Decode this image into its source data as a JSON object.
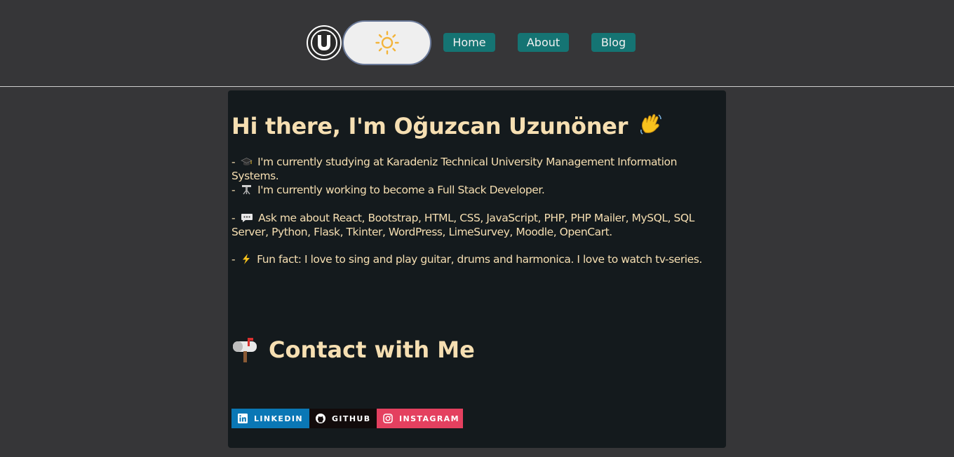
{
  "header": {
    "logo_icon": "u-logo-icon",
    "theme_toggle_icon": "sun-icon",
    "nav": [
      {
        "label": "Home"
      },
      {
        "label": "About"
      },
      {
        "label": "Blog"
      }
    ],
    "colors": {
      "nav_bg": "#157473",
      "background": "#363638"
    }
  },
  "main": {
    "title": "Hi there, I'm Oğuzcan Uzunöner",
    "title_emoji": "waving-hand-icon",
    "lines": [
      {
        "prefix": "-",
        "icon": "graduation-cap-icon",
        "text": "I'm currently studying at Karadeniz Technical University Management Information Systems."
      },
      {
        "prefix": "-",
        "icon": "telescope-icon",
        "text": "I'm currently working to become a Full Stack Developer."
      },
      {
        "prefix": "-",
        "icon": "speech-bubble-icon",
        "text": "Ask me about React, Bootstrap, HTML, CSS, JavaScript, PHP, PHP Mailer, MySQL, SQL Server, Python, Flask, Tkinter, WordPress, LimeSurvey, Moodle, OpenCart."
      },
      {
        "prefix": "-",
        "icon": "lightning-icon",
        "text": "Fun fact: I love to sing and play guitar, drums and harmonica. I love to watch tv-series."
      }
    ],
    "contact_title": "Contact with Me",
    "contact_icon": "mailbox-icon",
    "badges": [
      {
        "label": "LINKEDIN",
        "icon": "linkedin-icon",
        "color": "#0a77b5"
      },
      {
        "label": "GITHUB",
        "icon": "github-icon",
        "color": "#120b0b"
      },
      {
        "label": "INSTAGRAM",
        "icon": "instagram-icon",
        "color": "#e4405f"
      }
    ]
  }
}
